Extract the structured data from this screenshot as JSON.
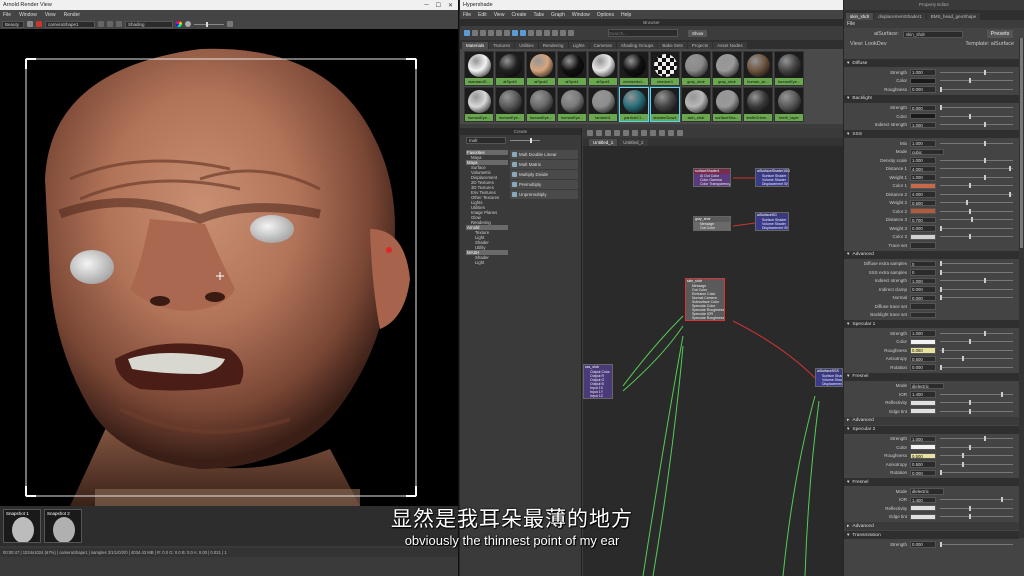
{
  "arnold": {
    "title": "Arnold Render View",
    "menu": [
      "File",
      "Window",
      "View",
      "Render"
    ],
    "toolbar": {
      "aov": "Beauty",
      "camera": "cameraShape1",
      "mode": "Shading"
    },
    "snapshots": [
      "Snapshot 1",
      "Snapshot 2"
    ],
    "status": "00:00:47 | 1024x1024 (67%) | cameraShape1 | samples 3/1/1/0/2/0 | 4034.43 MB | R: 0.0 G: 0.0 B: 0.0 A: 0.00 | 0.021 | 1"
  },
  "hypershade": {
    "title": "Hypershade",
    "menu": [
      "File",
      "Edit",
      "View",
      "Create",
      "Tabs",
      "Graph",
      "Window",
      "Options",
      "Help"
    ],
    "browser_title": "Browser",
    "search_placeholder": "Search...",
    "show_button": "Show",
    "tabs": [
      "Materials",
      "Textures",
      "Utilities",
      "Rendering",
      "Lights",
      "Cameras",
      "Shading Groups",
      "Bake Sets",
      "Projects",
      "Asset Nodes"
    ],
    "swatches_row1": [
      {
        "label": "standardS...",
        "color": "#f2f2f2"
      },
      {
        "label": "aiSpot3",
        "color": "#222222"
      },
      {
        "label": "aiSpot2",
        "color": "#d7a57d"
      },
      {
        "label": "aiSpot1",
        "color": "#111111"
      },
      {
        "label": "aiSpot1",
        "color": "#e8e8e8"
      },
      {
        "label": "checkerbd...",
        "color": "#111111"
      },
      {
        "label": "checker1",
        "color": "#eeeeee"
      },
      {
        "label": "gray_shdr",
        "color": "#8a8a8a"
      },
      {
        "label": "gray_shdr",
        "color": "#9a9a9a"
      },
      {
        "label": "human_sk...",
        "color": "#6e5540"
      },
      {
        "label": "humanEye...",
        "color": "#444444"
      }
    ],
    "swatches_row2": [
      {
        "label": "humanEye...",
        "color": "#d8d8d8"
      },
      {
        "label": "humanEye...",
        "color": "#5a5a5a"
      },
      {
        "label": "humanEye...",
        "color": "#6a6a6a"
      },
      {
        "label": "humanEye...",
        "color": "#7a7a7a"
      },
      {
        "label": "lambert1",
        "color": "#8d8d8d"
      },
      {
        "label": "particleCl...",
        "color": "#2a6f7a"
      },
      {
        "label": "shaderGlow1",
        "color": "#444444"
      },
      {
        "label": "skin_shdr",
        "color": "#b8b8b8"
      },
      {
        "label": "surfaceSha...",
        "color": "#9a9a9a"
      },
      {
        "label": "teethGrime...",
        "color": "#3a3a3a"
      },
      {
        "label": "teeth_layer",
        "color": "#5a5a5a"
      }
    ],
    "create_title": "Create",
    "create_search": "mult",
    "tree": [
      {
        "t": "h",
        "label": "Favorites"
      },
      {
        "t": "i",
        "label": "Maya"
      },
      {
        "t": "h",
        "label": "Maya"
      },
      {
        "t": "i",
        "label": "Surface"
      },
      {
        "t": "i",
        "label": "Volumetric"
      },
      {
        "t": "i",
        "label": "Displacement"
      },
      {
        "t": "i",
        "label": "2D Textures"
      },
      {
        "t": "i",
        "label": "3D Textures"
      },
      {
        "t": "i",
        "label": "Env Textures"
      },
      {
        "t": "i",
        "label": "Other Textures"
      },
      {
        "t": "i",
        "label": "Lights"
      },
      {
        "t": "i",
        "label": "Utilities"
      },
      {
        "t": "i",
        "label": "Image Planes"
      },
      {
        "t": "i",
        "label": "Glow"
      },
      {
        "t": "i",
        "label": "Rendering"
      },
      {
        "t": "h",
        "label": "Arnold"
      },
      {
        "t": "ii",
        "label": "Texture"
      },
      {
        "t": "ii",
        "label": "Light"
      },
      {
        "t": "ii",
        "label": "Shader"
      },
      {
        "t": "ii",
        "label": "Utility"
      },
      {
        "t": "h",
        "label": "MASH"
      },
      {
        "t": "ii",
        "label": "Shader"
      },
      {
        "t": "ii",
        "label": "Light"
      }
    ],
    "create_items": [
      "Mult Double Linear",
      "Mult Matrix",
      "Multiply Divide",
      "Premultiply",
      "Unpremultiply"
    ],
    "graph_tabs": [
      "Untitled_1",
      "Untitled_2"
    ],
    "nodes": [
      {
        "name": "surfaceShader1",
        "rows": [
          "Ai Out Color",
          "Color Gamma",
          "Color Transparency"
        ]
      },
      {
        "name": "aiSurfaceShader1SG",
        "rows": [
          "Surface Shader",
          "Volume Shader",
          "Displacement Shader"
        ]
      },
      {
        "name": "gray_shdr",
        "rows": [
          "Message",
          "Out Color"
        ]
      },
      {
        "name": "aiSurfaceSG",
        "rows": [
          "Surface Shader",
          "Volume Shader",
          "Displacement Shader"
        ]
      },
      {
        "name": "skin_shdr",
        "rows": [
          "Message",
          "Out Color",
          "Emission Color",
          "Normal Camera",
          "Subsurface Color",
          "Specular Color",
          "Specular Roughness",
          "Specular IOR",
          "Specular Roughness2"
        ]
      },
      {
        "name": "sss_shdr",
        "rows": [
          "Output Color",
          "Output R",
          "Output G",
          "Output B",
          "Input 1X",
          "Input 1Y",
          "Input 1Z"
        ]
      },
      {
        "name": "aiSurfaceSSS",
        "rows": [
          "Surface Shader",
          "Volume Shader",
          "Displacement Shader"
        ]
      }
    ]
  },
  "props": {
    "title": "Property Editor",
    "tabs": [
      "skin_shdr",
      "displacementShader1",
      "BMS_head_geoShape"
    ],
    "menu": [
      "File"
    ],
    "type_label": "aiSurface:",
    "type_value": "skin_shdr",
    "presets": "Presets",
    "view_mode": "View: LookDev",
    "template": "Template: aiSurface",
    "sections": [
      {
        "name": "Diffuse",
        "rows": [
          [
            "Strength",
            "1.000"
          ],
          [
            "Color",
            ""
          ],
          [
            "Roughness",
            "0.000"
          ]
        ]
      },
      {
        "name": "Backlight",
        "rows": [
          [
            "Strength",
            "0.000"
          ],
          [
            "Color",
            ""
          ],
          [
            "Indirect strength",
            "1.000"
          ]
        ]
      },
      {
        "name": "SSS",
        "rows": [
          [
            "Mix",
            "1.000"
          ],
          [
            "Mode",
            "cubic"
          ],
          [
            "Density scale",
            "1.000"
          ],
          [
            "Distance 1",
            "4.000"
          ],
          [
            "Weight 1",
            "1.000"
          ],
          [
            "Color 1",
            ""
          ],
          [
            "Distance 2",
            "4.000"
          ],
          [
            "Weight 2",
            "0.600"
          ],
          [
            "Color 2",
            ""
          ],
          [
            "Distance 3",
            "0.700"
          ],
          [
            "Weight 3",
            "0.000"
          ],
          [
            "Color 3",
            ""
          ],
          [
            "Trace set",
            ""
          ]
        ]
      },
      {
        "name": "Advanced",
        "rows": [
          [
            "Diffuse extra samples",
            "0"
          ],
          [
            "SSS extra samples",
            "0"
          ],
          [
            "Indirect strength",
            "1.000"
          ],
          [
            "Indirect clamp",
            "0.000"
          ],
          [
            "Normal",
            "0.000"
          ],
          [
            "Diffuse trace set",
            ""
          ],
          [
            "Backlight trace set",
            ""
          ]
        ]
      },
      {
        "name": "Specular 1",
        "rows": [
          [
            "Strength",
            "1.000"
          ],
          [
            "Color",
            ""
          ],
          [
            "Roughness",
            "0.050"
          ],
          [
            "Anisotropy",
            "0.500"
          ],
          [
            "Rotation",
            "0.000"
          ]
        ]
      },
      {
        "name": "Fresnel",
        "rows": [
          [
            "Mode",
            "dielectric"
          ],
          [
            "IOR",
            "1.400"
          ],
          [
            "Reflectivity",
            ""
          ],
          [
            "Edge tint",
            ""
          ]
        ]
      },
      {
        "name": "Advanced",
        "rows": []
      },
      {
        "name": "Specular 2",
        "rows": [
          [
            "Strength",
            "1.000"
          ],
          [
            "Color",
            ""
          ],
          [
            "Roughness",
            "0.500"
          ],
          [
            "Anisotropy",
            "0.500"
          ],
          [
            "Rotation",
            "0.000"
          ]
        ]
      },
      {
        "name": "Fresnel",
        "rows": [
          [
            "Mode",
            "dielectric"
          ],
          [
            "IOR",
            "1.400"
          ],
          [
            "Reflectivity",
            ""
          ],
          [
            "Edge tint",
            ""
          ]
        ]
      },
      {
        "name": "Advanced",
        "rows": []
      },
      {
        "name": "Transmission",
        "rows": [
          [
            "Strength",
            "0.000"
          ]
        ]
      }
    ]
  },
  "subtitle": {
    "cn": "显然是我耳朵最薄的地方",
    "en": "obviously the thinnest point of my ear"
  }
}
